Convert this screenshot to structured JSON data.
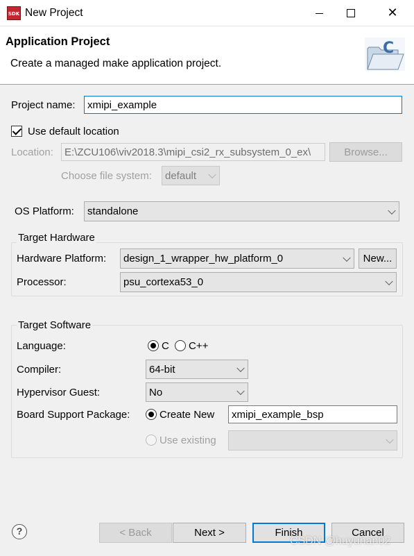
{
  "window": {
    "app_icon_text": "SDK",
    "title": "New Project"
  },
  "banner": {
    "title": "Application Project",
    "subtitle": "Create a managed make application project."
  },
  "project": {
    "name_label": "Project name:",
    "name_value": "xmipi_example",
    "use_default_location_label": "Use default location",
    "use_default_location_checked": true,
    "location_label": "Location:",
    "location_value": "E:\\ZCU106\\viv2018.3\\mipi_csi2_rx_subsystem_0_ex\\",
    "browse_label": "Browse...",
    "file_system_label": "Choose file system:",
    "file_system_value": "default"
  },
  "os_platform": {
    "label": "OS Platform:",
    "value": "standalone"
  },
  "target_hardware": {
    "title": "Target Hardware",
    "platform_label": "Hardware Platform:",
    "platform_value": "design_1_wrapper_hw_platform_0",
    "new_label": "New...",
    "processor_label": "Processor:",
    "processor_value": "psu_cortexa53_0"
  },
  "target_software": {
    "title": "Target Software",
    "language_label": "Language:",
    "language_options": [
      "C",
      "C++"
    ],
    "language_selected": "C",
    "compiler_label": "Compiler:",
    "compiler_value": "64-bit",
    "hypervisor_label": "Hypervisor Guest:",
    "hypervisor_value": "No",
    "bsp_label": "Board Support Package:",
    "bsp_create_new_label": "Create New",
    "bsp_name_value": "xmipi_example_bsp",
    "bsp_use_existing_label": "Use existing",
    "bsp_existing_value": ""
  },
  "footer": {
    "help_glyph": "?",
    "back_label": "< Back",
    "next_label": "Next >",
    "finish_label": "Finish",
    "cancel_label": "Cancel"
  },
  "watermark": "CSDN @huyuhan02",
  "colors": {
    "accent": "#0078d7",
    "brand": "#c1272d",
    "disabled_text": "#a0a0a0"
  }
}
